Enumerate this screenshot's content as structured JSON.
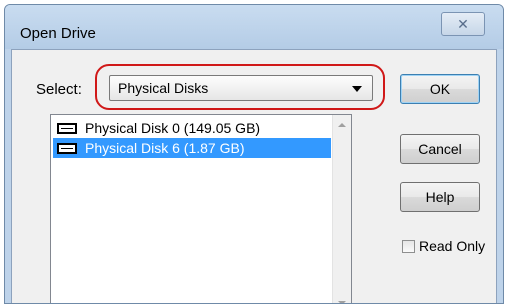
{
  "window": {
    "title": "Open Drive",
    "close_glyph": "✕"
  },
  "select": {
    "label": "Select:",
    "value": "Physical Disks",
    "highlight_color": "#d01818"
  },
  "list": {
    "items": [
      {
        "label": "Physical Disk 0 (149.05 GB)",
        "icon": "hard-disk-icon",
        "selected": false
      },
      {
        "label": "Physical Disk 6 (1.87 GB)",
        "icon": "hard-disk-icon",
        "selected": true
      }
    ]
  },
  "buttons": {
    "ok": "OK",
    "cancel": "Cancel",
    "help": "Help"
  },
  "read_only": {
    "label": "Read Only",
    "checked": false
  },
  "colors": {
    "selection": "#3399ff",
    "title_bar": "#bed3ea"
  }
}
